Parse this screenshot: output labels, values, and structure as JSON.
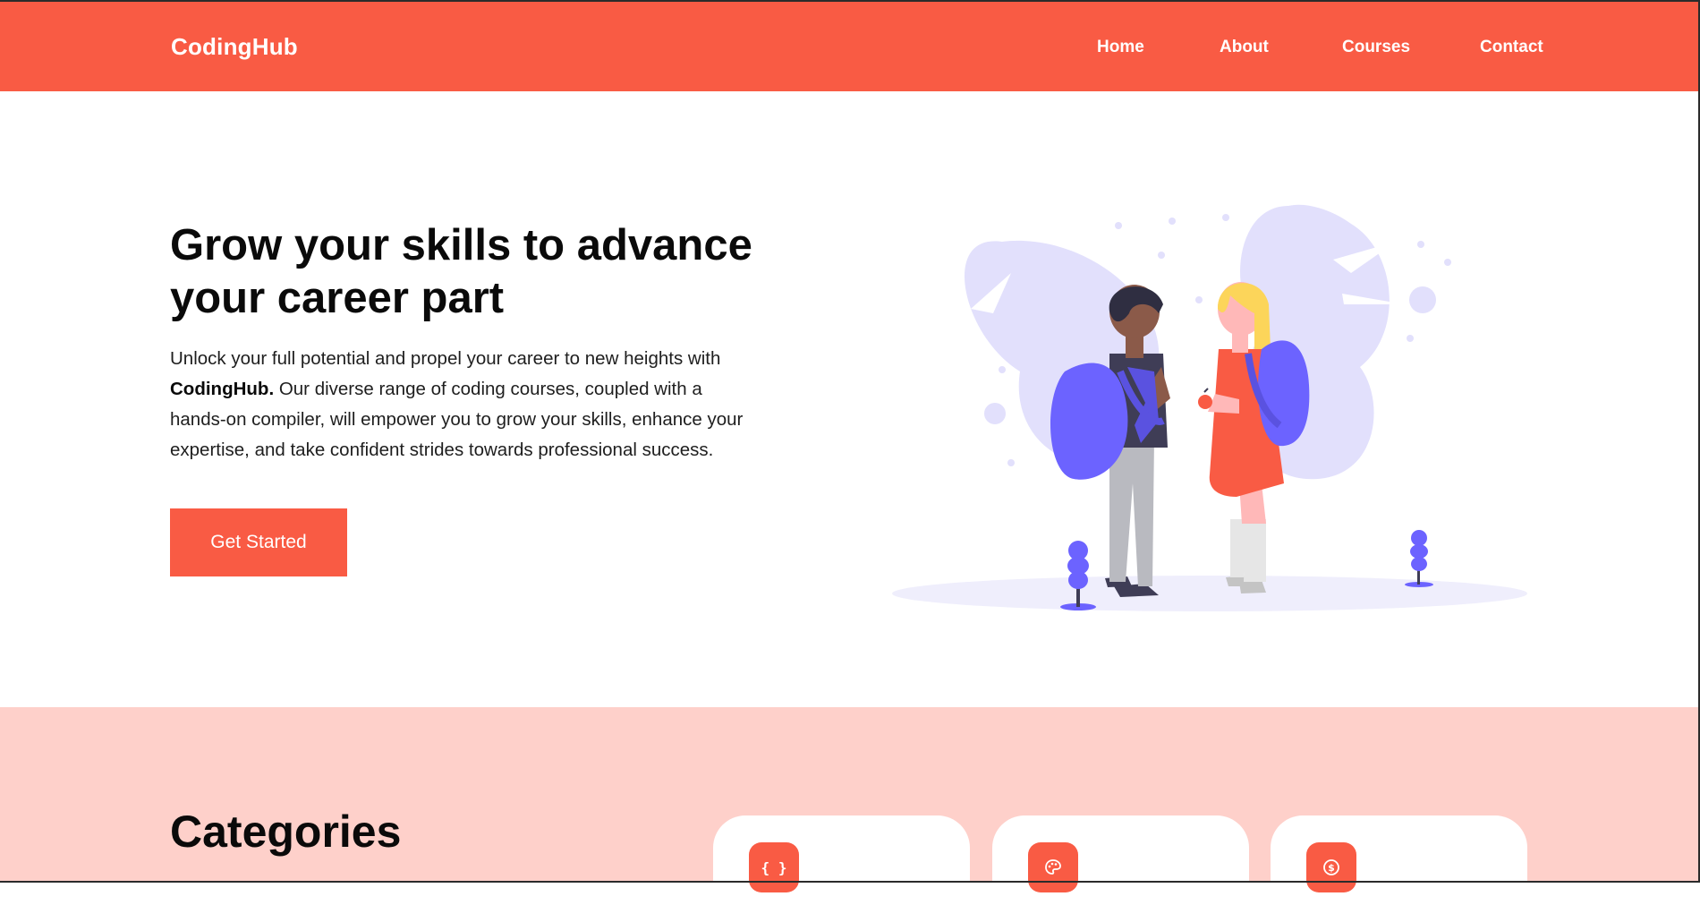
{
  "brand": "CodingHub",
  "nav": [
    "Home",
    "About",
    "Courses",
    "Contact"
  ],
  "hero": {
    "title_line1": "Grow your skills to advance",
    "title_line2": "your career part",
    "desc_line1": "Unlock your full potential and propel your career to new heights with",
    "desc_bold": "CodingHub.",
    "desc_line2_rest": " Our diverse range of coding courses, coupled with a",
    "desc_line3": "hands-on compiler, will empower you to grow your skills, enhance your",
    "desc_line4": "expertise, and take confident strides towards professional success.",
    "cta": "Get Started"
  },
  "categories": {
    "title": "Categories",
    "cards": [
      {
        "icon": "code-braces-icon",
        "glyph": "{ }"
      },
      {
        "icon": "palette-icon",
        "glyph": "🎨"
      },
      {
        "icon": "dollar-icon",
        "glyph": "$"
      }
    ]
  },
  "colors": {
    "accent": "#f95b44",
    "band": "#fed0ca",
    "illustration_primary": "#6c63ff",
    "illustration_light": "#e2e0fc"
  }
}
